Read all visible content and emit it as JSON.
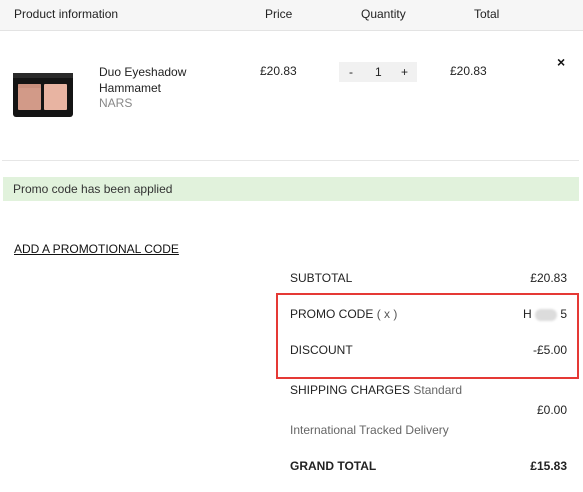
{
  "header": {
    "product_info": "Product information",
    "price": "Price",
    "quantity": "Quantity",
    "total": "Total"
  },
  "item": {
    "name": "Duo Eyeshadow Hammamet",
    "brand": "NARS",
    "price": "£20.83",
    "quantity": "1",
    "decrement_label": "-",
    "increment_label": "+",
    "total": "£20.83",
    "remove_label": "×"
  },
  "banner": {
    "message": "Promo code has been applied",
    "color": "#e1f2dc"
  },
  "add_promo_label": "ADD A PROMOTIONAL CODE",
  "summary": {
    "subtotal_label": "SUBTOTAL",
    "subtotal_value": "£20.83",
    "promo_label": "PROMO CODE",
    "promo_remove": "( x )",
    "promo_value_start": "H",
    "promo_value_end": "5",
    "discount_label": "DISCOUNT",
    "discount_value": "-£5.00",
    "shipping_label": "SHIPPING CHARGES",
    "shipping_type": "Standard",
    "shipping_value": "£0.00",
    "shipping_method": "International Tracked Delivery",
    "grand_total_label": "GRAND TOTAL",
    "grand_total_value": "£15.83"
  },
  "highlight_color": "#e53935"
}
